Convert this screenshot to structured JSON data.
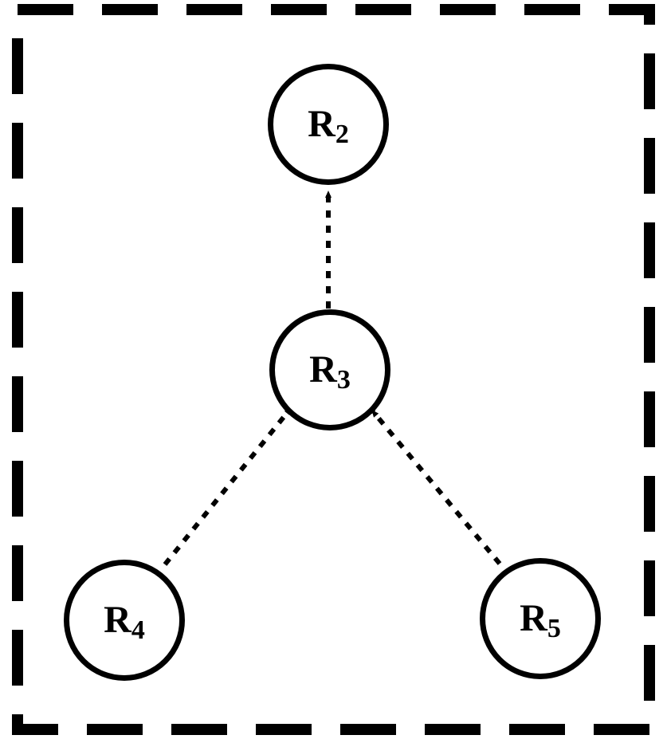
{
  "diagram": {
    "nodes": {
      "r2": {
        "letter": "R",
        "sub": "2"
      },
      "r3": {
        "letter": "R",
        "sub": "3"
      },
      "r4": {
        "letter": "R",
        "sub": "4"
      },
      "r5": {
        "letter": "R",
        "sub": "5"
      }
    },
    "edges": [
      {
        "from": "r3",
        "to": "r2",
        "style": "dashed",
        "arrow": true
      },
      {
        "from": "r4",
        "to": "r3",
        "style": "dashed",
        "arrow": true
      },
      {
        "from": "r5",
        "to": "r3",
        "style": "dashed",
        "arrow": true
      }
    ],
    "border": {
      "style": "dashed"
    }
  }
}
